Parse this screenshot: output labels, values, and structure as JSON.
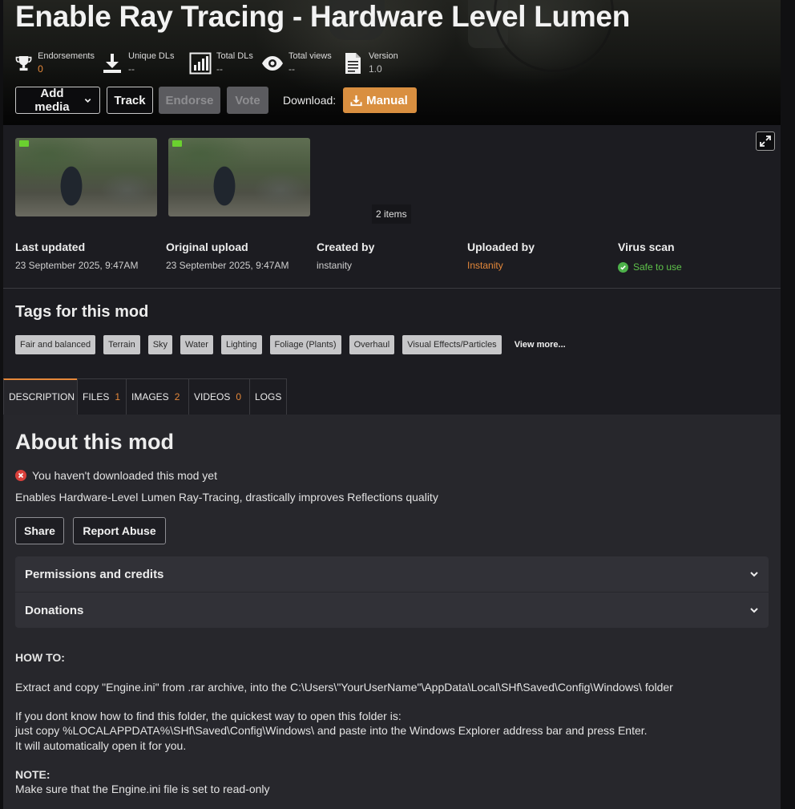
{
  "mod": {
    "title": "Enable Ray Tracing - Hardware Level Lumen"
  },
  "stats": [
    {
      "label": "Endorsements",
      "value": "0",
      "icon": "trophy-icon"
    },
    {
      "label": "Unique DLs",
      "value": "--",
      "icon": "download-icon"
    },
    {
      "label": "Total DLs",
      "value": "--",
      "icon": "bar-chart-icon"
    },
    {
      "label": "Total views",
      "value": "--",
      "icon": "eye-icon"
    },
    {
      "label": "Version",
      "value": "1.0",
      "icon": "document-icon"
    }
  ],
  "actions": {
    "add_media": "Add media",
    "track": "Track",
    "endorse": "Endorse",
    "vote": "Vote",
    "download_label": "Download:",
    "manual": "Manual"
  },
  "gallery": {
    "items_count": "2 items"
  },
  "meta": {
    "last_updated_label": "Last updated",
    "last_updated": "23 September 2025, 9:47AM",
    "original_upload_label": "Original upload",
    "original_upload": "23 September 2025, 9:47AM",
    "created_by_label": "Created by",
    "created_by": "instanity",
    "uploaded_by_label": "Uploaded by",
    "uploaded_by": "Instanity",
    "virus_scan_label": "Virus scan",
    "virus_scan": "Safe to use"
  },
  "tags": {
    "title": "Tags for this mod",
    "items": [
      "Fair and balanced",
      "Terrain",
      "Sky",
      "Water",
      "Lighting",
      "Foliage (Plants)",
      "Overhaul",
      "Visual Effects/Particles"
    ],
    "view_more": "View more..."
  },
  "tabs": [
    {
      "label": "DESCRIPTION",
      "count": ""
    },
    {
      "label": "FILES",
      "count": "1"
    },
    {
      "label": "IMAGES",
      "count": "2"
    },
    {
      "label": "VIDEOS",
      "count": "0"
    },
    {
      "label": "LOGS",
      "count": ""
    }
  ],
  "description": {
    "about_title": "About this mod",
    "not_downloaded": "You haven't downloaded this mod yet",
    "summary": "Enables Hardware-Level Lumen Ray-Tracing, drastically improves Reflections quality",
    "share": "Share",
    "report": "Report Abuse",
    "permissions": "Permissions and credits",
    "donations": "Donations",
    "howto_title": "HOW TO:",
    "howto_line": "Extract and copy \"Engine.ini\" from .rar archive, into the C:\\Users\\\"YourUserName\"\\AppData\\Local\\SHf\\Saved\\Config\\Windows\\      folder",
    "tip_line1": "If you dont know how to find this folder, the quickest way to open this folder is:",
    "tip_line2": "just copy %LOCALAPPDATA%\\SHf\\Saved\\Config\\Windows\\ and paste into the Windows Explorer address bar and press Enter.",
    "tip_line3": "It will automatically open it for you.",
    "note_title": "NOTE:",
    "note_line": "Make sure that the Engine.ini file is set to read-only"
  },
  "colors": {
    "accent": "#e5883a",
    "safe": "#5ec24a",
    "error": "#d9403b"
  }
}
